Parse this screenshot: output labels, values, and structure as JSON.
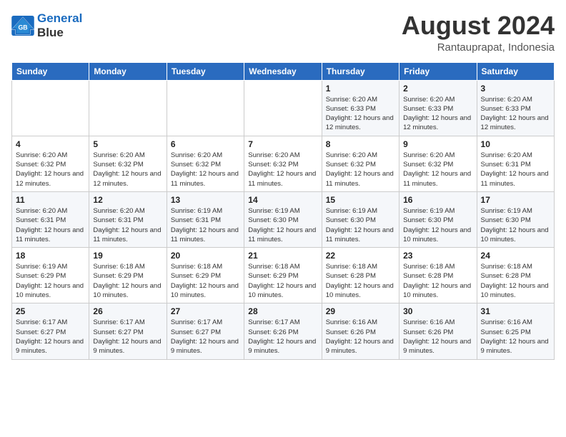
{
  "header": {
    "logo_line1": "General",
    "logo_line2": "Blue",
    "title": "August 2024",
    "subtitle": "Rantauprapat, Indonesia"
  },
  "weekdays": [
    "Sunday",
    "Monday",
    "Tuesday",
    "Wednesday",
    "Thursday",
    "Friday",
    "Saturday"
  ],
  "weeks": [
    [
      {
        "day": "",
        "sunrise": "",
        "sunset": "",
        "daylight": ""
      },
      {
        "day": "",
        "sunrise": "",
        "sunset": "",
        "daylight": ""
      },
      {
        "day": "",
        "sunrise": "",
        "sunset": "",
        "daylight": ""
      },
      {
        "day": "",
        "sunrise": "",
        "sunset": "",
        "daylight": ""
      },
      {
        "day": "1",
        "sunrise": "Sunrise: 6:20 AM",
        "sunset": "Sunset: 6:33 PM",
        "daylight": "Daylight: 12 hours and 12 minutes."
      },
      {
        "day": "2",
        "sunrise": "Sunrise: 6:20 AM",
        "sunset": "Sunset: 6:33 PM",
        "daylight": "Daylight: 12 hours and 12 minutes."
      },
      {
        "day": "3",
        "sunrise": "Sunrise: 6:20 AM",
        "sunset": "Sunset: 6:33 PM",
        "daylight": "Daylight: 12 hours and 12 minutes."
      }
    ],
    [
      {
        "day": "4",
        "sunrise": "Sunrise: 6:20 AM",
        "sunset": "Sunset: 6:32 PM",
        "daylight": "Daylight: 12 hours and 12 minutes."
      },
      {
        "day": "5",
        "sunrise": "Sunrise: 6:20 AM",
        "sunset": "Sunset: 6:32 PM",
        "daylight": "Daylight: 12 hours and 12 minutes."
      },
      {
        "day": "6",
        "sunrise": "Sunrise: 6:20 AM",
        "sunset": "Sunset: 6:32 PM",
        "daylight": "Daylight: 12 hours and 11 minutes."
      },
      {
        "day": "7",
        "sunrise": "Sunrise: 6:20 AM",
        "sunset": "Sunset: 6:32 PM",
        "daylight": "Daylight: 12 hours and 11 minutes."
      },
      {
        "day": "8",
        "sunrise": "Sunrise: 6:20 AM",
        "sunset": "Sunset: 6:32 PM",
        "daylight": "Daylight: 12 hours and 11 minutes."
      },
      {
        "day": "9",
        "sunrise": "Sunrise: 6:20 AM",
        "sunset": "Sunset: 6:32 PM",
        "daylight": "Daylight: 12 hours and 11 minutes."
      },
      {
        "day": "10",
        "sunrise": "Sunrise: 6:20 AM",
        "sunset": "Sunset: 6:31 PM",
        "daylight": "Daylight: 12 hours and 11 minutes."
      }
    ],
    [
      {
        "day": "11",
        "sunrise": "Sunrise: 6:20 AM",
        "sunset": "Sunset: 6:31 PM",
        "daylight": "Daylight: 12 hours and 11 minutes."
      },
      {
        "day": "12",
        "sunrise": "Sunrise: 6:20 AM",
        "sunset": "Sunset: 6:31 PM",
        "daylight": "Daylight: 12 hours and 11 minutes."
      },
      {
        "day": "13",
        "sunrise": "Sunrise: 6:19 AM",
        "sunset": "Sunset: 6:31 PM",
        "daylight": "Daylight: 12 hours and 11 minutes."
      },
      {
        "day": "14",
        "sunrise": "Sunrise: 6:19 AM",
        "sunset": "Sunset: 6:30 PM",
        "daylight": "Daylight: 12 hours and 11 minutes."
      },
      {
        "day": "15",
        "sunrise": "Sunrise: 6:19 AM",
        "sunset": "Sunset: 6:30 PM",
        "daylight": "Daylight: 12 hours and 11 minutes."
      },
      {
        "day": "16",
        "sunrise": "Sunrise: 6:19 AM",
        "sunset": "Sunset: 6:30 PM",
        "daylight": "Daylight: 12 hours and 10 minutes."
      },
      {
        "day": "17",
        "sunrise": "Sunrise: 6:19 AM",
        "sunset": "Sunset: 6:30 PM",
        "daylight": "Daylight: 12 hours and 10 minutes."
      }
    ],
    [
      {
        "day": "18",
        "sunrise": "Sunrise: 6:19 AM",
        "sunset": "Sunset: 6:29 PM",
        "daylight": "Daylight: 12 hours and 10 minutes."
      },
      {
        "day": "19",
        "sunrise": "Sunrise: 6:18 AM",
        "sunset": "Sunset: 6:29 PM",
        "daylight": "Daylight: 12 hours and 10 minutes."
      },
      {
        "day": "20",
        "sunrise": "Sunrise: 6:18 AM",
        "sunset": "Sunset: 6:29 PM",
        "daylight": "Daylight: 12 hours and 10 minutes."
      },
      {
        "day": "21",
        "sunrise": "Sunrise: 6:18 AM",
        "sunset": "Sunset: 6:29 PM",
        "daylight": "Daylight: 12 hours and 10 minutes."
      },
      {
        "day": "22",
        "sunrise": "Sunrise: 6:18 AM",
        "sunset": "Sunset: 6:28 PM",
        "daylight": "Daylight: 12 hours and 10 minutes."
      },
      {
        "day": "23",
        "sunrise": "Sunrise: 6:18 AM",
        "sunset": "Sunset: 6:28 PM",
        "daylight": "Daylight: 12 hours and 10 minutes."
      },
      {
        "day": "24",
        "sunrise": "Sunrise: 6:18 AM",
        "sunset": "Sunset: 6:28 PM",
        "daylight": "Daylight: 12 hours and 10 minutes."
      }
    ],
    [
      {
        "day": "25",
        "sunrise": "Sunrise: 6:17 AM",
        "sunset": "Sunset: 6:27 PM",
        "daylight": "Daylight: 12 hours and 9 minutes."
      },
      {
        "day": "26",
        "sunrise": "Sunrise: 6:17 AM",
        "sunset": "Sunset: 6:27 PM",
        "daylight": "Daylight: 12 hours and 9 minutes."
      },
      {
        "day": "27",
        "sunrise": "Sunrise: 6:17 AM",
        "sunset": "Sunset: 6:27 PM",
        "daylight": "Daylight: 12 hours and 9 minutes."
      },
      {
        "day": "28",
        "sunrise": "Sunrise: 6:17 AM",
        "sunset": "Sunset: 6:26 PM",
        "daylight": "Daylight: 12 hours and 9 minutes."
      },
      {
        "day": "29",
        "sunrise": "Sunrise: 6:16 AM",
        "sunset": "Sunset: 6:26 PM",
        "daylight": "Daylight: 12 hours and 9 minutes."
      },
      {
        "day": "30",
        "sunrise": "Sunrise: 6:16 AM",
        "sunset": "Sunset: 6:26 PM",
        "daylight": "Daylight: 12 hours and 9 minutes."
      },
      {
        "day": "31",
        "sunrise": "Sunrise: 6:16 AM",
        "sunset": "Sunset: 6:25 PM",
        "daylight": "Daylight: 12 hours and 9 minutes."
      }
    ]
  ]
}
